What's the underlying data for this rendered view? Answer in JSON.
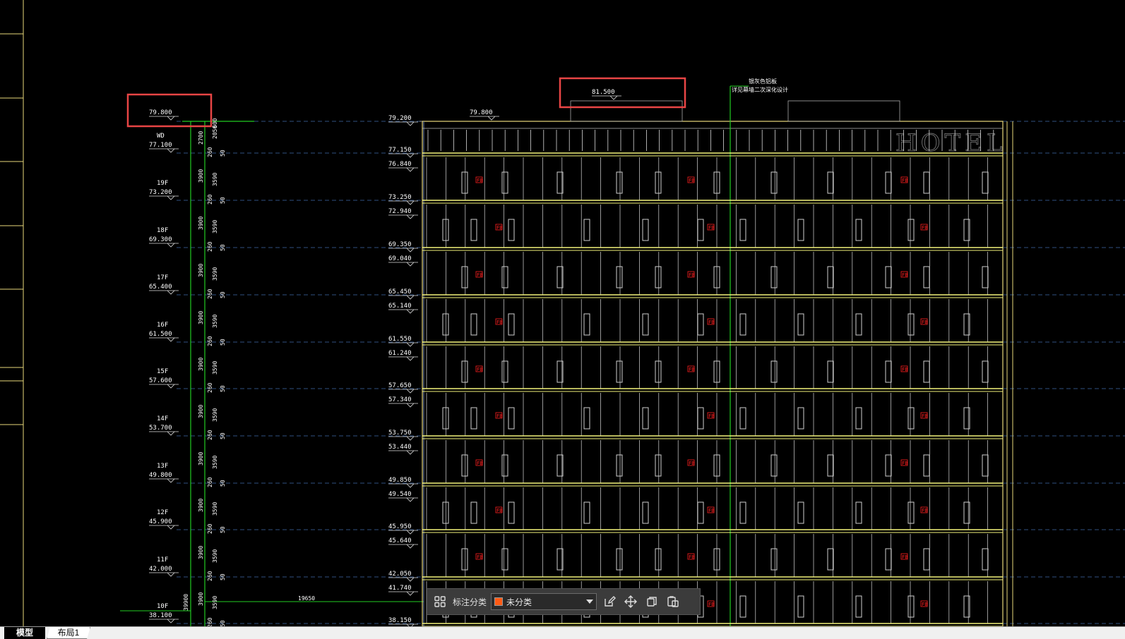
{
  "colors": {
    "background": "#000000",
    "frame_yellow": "#e8d87a",
    "slab_yellow": "#f2f27a",
    "grid_green": "#22cc22",
    "dash_blue": "#2f4f7f",
    "highlight_red": "#e84545",
    "toolbar_bg": "#3b3b3b",
    "swatch_orange": "#ff5a14"
  },
  "drawing": {
    "top_left_level": "79.800",
    "left_top_note": "600",
    "roof_level": "81.500",
    "parapet_level": "79.800",
    "right_note_line1": "银灰色铝板",
    "right_note_line2": "详见幕墙二次深化设计",
    "watermark": "HOTEL",
    "horizontal_dim": "19650",
    "bottom_dim_left": "39900",
    "left_levels": [
      {
        "floor": "WD",
        "elev": "77.100",
        "dims": [
          "2700",
          "2050",
          "50"
        ]
      },
      {
        "floor": "19F",
        "elev": "73.200",
        "dims": [
          "3900",
          "3590",
          "50"
        ]
      },
      {
        "floor": "18F",
        "elev": "69.300",
        "dims": [
          "3900",
          "3590",
          "50"
        ]
      },
      {
        "floor": "17F",
        "elev": "65.400",
        "dims": [
          "3900",
          "3590",
          "50"
        ]
      },
      {
        "floor": "16F",
        "elev": "61.500",
        "dims": [
          "3900",
          "3590",
          "50"
        ]
      },
      {
        "floor": "15F",
        "elev": "57.600",
        "dims": [
          "3900",
          "3590",
          "50"
        ]
      },
      {
        "floor": "14F",
        "elev": "53.700",
        "dims": [
          "3900",
          "3590",
          "50"
        ]
      },
      {
        "floor": "13F",
        "elev": "49.800",
        "dims": [
          "3900",
          "3590",
          "50"
        ]
      },
      {
        "floor": "12F",
        "elev": "45.900",
        "dims": [
          "3900",
          "3590",
          "50"
        ]
      },
      {
        "floor": "11F",
        "elev": "42.000",
        "dims": [
          "3900",
          "3590",
          "50"
        ]
      },
      {
        "floor": "10F",
        "elev": "38.100",
        "dims": [
          "3900",
          "3590",
          "50"
        ]
      }
    ],
    "slab_dim": "260",
    "right_levels": [
      {
        "upper": "79.200",
        "lower": ""
      },
      {
        "upper": "77.150",
        "lower": "76.840"
      },
      {
        "upper": "73.250",
        "lower": "72.940"
      },
      {
        "upper": "69.350",
        "lower": "69.040"
      },
      {
        "upper": "65.450",
        "lower": "65.140"
      },
      {
        "upper": "61.550",
        "lower": "61.240"
      },
      {
        "upper": "57.650",
        "lower": "57.340"
      },
      {
        "upper": "53.750",
        "lower": "53.440"
      },
      {
        "upper": "49.850",
        "lower": "49.540"
      },
      {
        "upper": "45.950",
        "lower": "45.640"
      },
      {
        "upper": "42.050",
        "lower": "41.740"
      },
      {
        "upper": "38.150",
        "lower": ""
      }
    ],
    "red_tag": "FB"
  },
  "toolbar": {
    "grid_icon": "grid-icon",
    "label": "标注分类",
    "selected": "未分类",
    "edit_icon": "edit-icon",
    "move_icon": "move-icon",
    "copy_icon": "copy-icon",
    "paste_icon": "paste-icon"
  },
  "tabs": {
    "model": "模型",
    "layout1": "布局1"
  }
}
